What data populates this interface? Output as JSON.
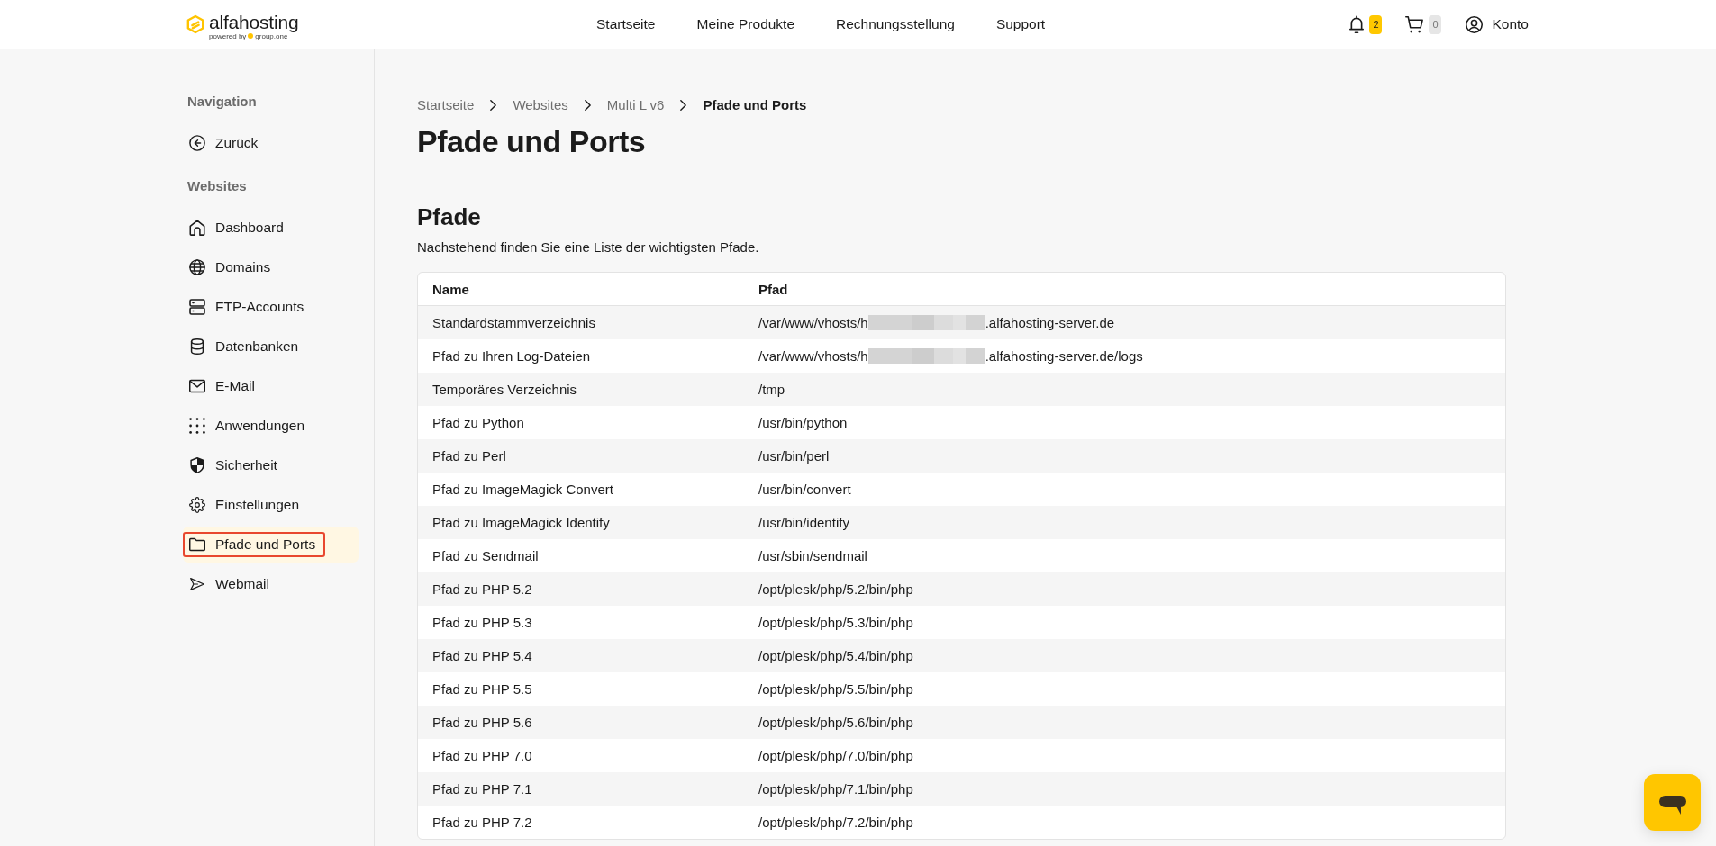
{
  "header": {
    "logo": {
      "wordmark": "alfahosting",
      "tagline": "powered by",
      "partner": "group.one"
    },
    "nav": [
      "Startseite",
      "Meine Produkte",
      "Rechnungsstellung",
      "Support"
    ],
    "notifications": {
      "count": "2"
    },
    "cart": {
      "count": "0"
    },
    "account": {
      "label": "Konto"
    }
  },
  "sidebar": {
    "sections": [
      {
        "title": "Navigation",
        "items": [
          {
            "label": "Zurück",
            "selected": false,
            "focused": false
          }
        ]
      },
      {
        "title": "Websites",
        "items": [
          {
            "label": "Dashboard",
            "selected": false,
            "focused": false
          },
          {
            "label": "Domains",
            "selected": false,
            "focused": false
          },
          {
            "label": "FTP-Accounts",
            "selected": false,
            "focused": false
          },
          {
            "label": "Datenbanken",
            "selected": false,
            "focused": false
          },
          {
            "label": "E-Mail",
            "selected": false,
            "focused": false
          },
          {
            "label": "Anwendungen",
            "selected": false,
            "focused": false
          },
          {
            "label": "Sicherheit",
            "selected": false,
            "focused": false
          },
          {
            "label": "Einstellungen",
            "selected": false,
            "focused": false
          },
          {
            "label": "Pfade und Ports",
            "selected": true,
            "focused": true
          },
          {
            "label": "Webmail",
            "selected": false,
            "focused": false
          }
        ]
      }
    ]
  },
  "breadcrumb": [
    {
      "label": "Startseite",
      "current": false
    },
    {
      "label": "Websites",
      "current": false
    },
    {
      "label": "Multi L v6",
      "current": false
    },
    {
      "label": "Pfade und Ports",
      "current": true
    }
  ],
  "page_title": "Pfade und Ports",
  "paths": {
    "title": "Pfade",
    "description": "Nachstehend finden Sie eine Liste der wichtigsten Pfade.",
    "table": {
      "columns": [
        "Name",
        "Pfad"
      ],
      "rows": [
        {
          "name": "Standardstammverzeichnis",
          "path": "/var/www/vhosts/h",
          "redacted": true,
          "path_end": ".alfahosting-server.de"
        },
        {
          "name": "Pfad zu Ihren Log-Dateien",
          "path": "/var/www/vhosts/h",
          "redacted": true,
          "path_end": ".alfahosting-server.de/logs"
        },
        {
          "name": "Temporäres Verzeichnis",
          "path": "/tmp",
          "redacted": false
        },
        {
          "name": "Pfad zu Python",
          "path": "/usr/bin/python",
          "redacted": false
        },
        {
          "name": "Pfad zu Perl",
          "path": "/usr/bin/perl",
          "redacted": false
        },
        {
          "name": "Pfad zu ImageMagick Convert",
          "path": "/usr/bin/convert",
          "redacted": false
        },
        {
          "name": "Pfad zu ImageMagick Identify",
          "path": "/usr/bin/identify",
          "redacted": false
        },
        {
          "name": "Pfad zu Sendmail",
          "path": "/usr/sbin/sendmail",
          "redacted": false
        },
        {
          "name": "Pfad zu PHP 5.2",
          "path": "/opt/plesk/php/5.2/bin/php",
          "redacted": false
        },
        {
          "name": "Pfad zu PHP 5.3",
          "path": "/opt/plesk/php/5.3/bin/php",
          "redacted": false
        },
        {
          "name": "Pfad zu PHP 5.4",
          "path": "/opt/plesk/php/5.4/bin/php",
          "redacted": false
        },
        {
          "name": "Pfad zu PHP 5.5",
          "path": "/opt/plesk/php/5.5/bin/php",
          "redacted": false
        },
        {
          "name": "Pfad zu PHP 5.6",
          "path": "/opt/plesk/php/5.6/bin/php",
          "redacted": false
        },
        {
          "name": "Pfad zu PHP 7.0",
          "path": "/opt/plesk/php/7.0/bin/php",
          "redacted": false
        },
        {
          "name": "Pfad zu PHP 7.1",
          "path": "/opt/plesk/php/7.1/bin/php",
          "redacted": false
        },
        {
          "name": "Pfad zu PHP 7.2",
          "path": "/opt/plesk/php/7.2/bin/php",
          "redacted": false
        }
      ]
    }
  }
}
